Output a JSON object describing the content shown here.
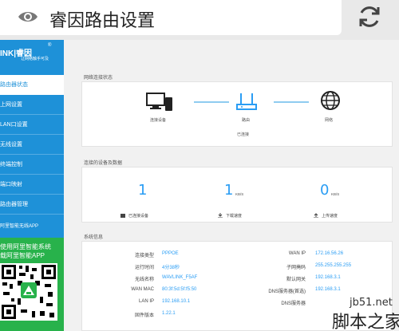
{
  "browser": {
    "title": "睿因路由设置"
  },
  "sidebar": {
    "logo_text": "INK|睿因",
    "logo_reg": "®",
    "logo_sub": "让网络触手可及",
    "items": [
      {
        "label": "路由器状态",
        "active": true
      },
      {
        "label": "上网设置"
      },
      {
        "label": "LAN口设置"
      },
      {
        "label": "无线设置"
      },
      {
        "label": "终端控制"
      },
      {
        "label": "端口映射"
      },
      {
        "label": "路由器管理"
      }
    ],
    "promo_head": "阿里智能无线APP",
    "promo_line1": "使用阿里智能系统",
    "promo_line2": "载阿里智能APP"
  },
  "network_status": {
    "title": "网络连接状态",
    "device_label": "连接设备",
    "router_label": "路由",
    "internet_label": "网络",
    "status": "已连接"
  },
  "devices": {
    "title": "连接的设备及数据",
    "connected_count": "1",
    "connected_label": "已连接设备",
    "download_value": "1",
    "download_unit": "KB/S",
    "download_label": "下载速度",
    "upload_value": "0",
    "upload_unit": "KB/S",
    "upload_label": "上传速度"
  },
  "system": {
    "title": "系统信息",
    "left": [
      {
        "label": "连接类型",
        "value": "PPPOE"
      },
      {
        "label": "运行时间",
        "value": "4分38秒"
      },
      {
        "label": "无线名称",
        "value": "WAVLINK_F5AF"
      },
      {
        "label": "WAN MAC",
        "value": "80:3f:5d:5f:f5:50"
      },
      {
        "label": "LAN IP",
        "value": "192.168.10.1"
      },
      {
        "label": "固件版本",
        "value": "1.22.1"
      }
    ],
    "right": [
      {
        "label": "WAN IP",
        "value": "172.16.56.26"
      },
      {
        "label": "子网掩码",
        "value": "255.255.255.255"
      },
      {
        "label": "默认网关",
        "value": "192.168.3.1"
      },
      {
        "label": "DNS服务器(首选)",
        "value": "192.168.3.1"
      },
      {
        "label": "DNS服务器",
        "value": ""
      }
    ]
  },
  "watermark": {
    "site": "jb51.net",
    "name": "脚本之家"
  },
  "colors": {
    "sidebar": "#1e91d8",
    "accent": "#2a9df4",
    "promo": "#28b24b"
  }
}
